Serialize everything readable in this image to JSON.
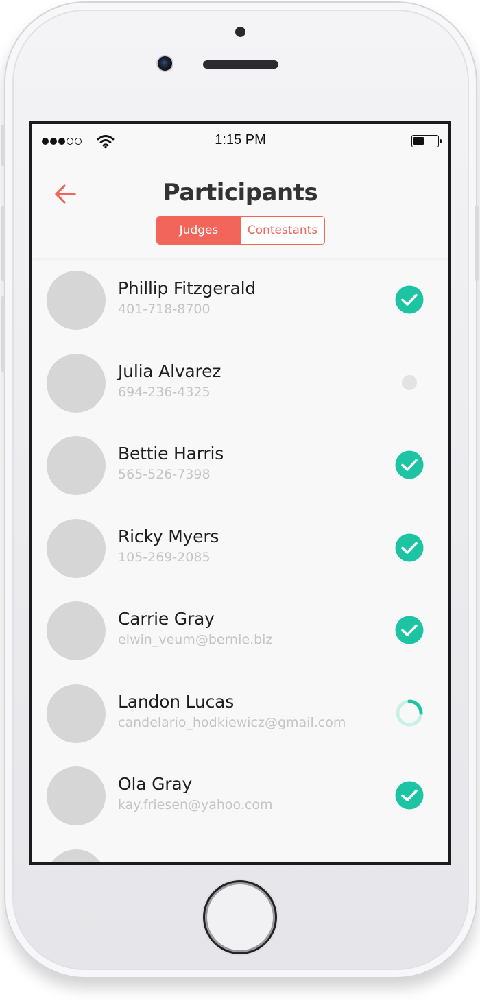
{
  "status_bar": {
    "time": "1:15 PM",
    "signal_bars": [
      true,
      true,
      true,
      false,
      false
    ],
    "battery_level": 0.4
  },
  "header": {
    "title": "Participants",
    "back_icon": "arrow-left-icon",
    "segments": [
      {
        "label": "Judges",
        "active": true
      },
      {
        "label": "Contestants",
        "active": false
      }
    ]
  },
  "colors": {
    "accent": "#f2655b",
    "success": "#1dc4a3",
    "avatar_placeholder": "#d6d6d6",
    "pending_dot": "#e3e3e3"
  },
  "participants": [
    {
      "name": "Phillip Fitzgerald",
      "contact": "401-718-8700",
      "status": "confirmed"
    },
    {
      "name": "Julia Alvarez",
      "contact": "694-236-4325",
      "status": "pending"
    },
    {
      "name": "Bettie Harris",
      "contact": "565-526-7398",
      "status": "confirmed"
    },
    {
      "name": "Ricky Myers",
      "contact": "105-269-2085",
      "status": "confirmed"
    },
    {
      "name": "Carrie Gray",
      "contact": "elwin_veum@bernie.biz",
      "status": "confirmed"
    },
    {
      "name": "Landon Lucas",
      "contact": "candelario_hodkiewicz@gmail.com",
      "status": "loading"
    },
    {
      "name": "Ola Gray",
      "contact": "kay.friesen@yahoo.com",
      "status": "confirmed"
    }
  ]
}
